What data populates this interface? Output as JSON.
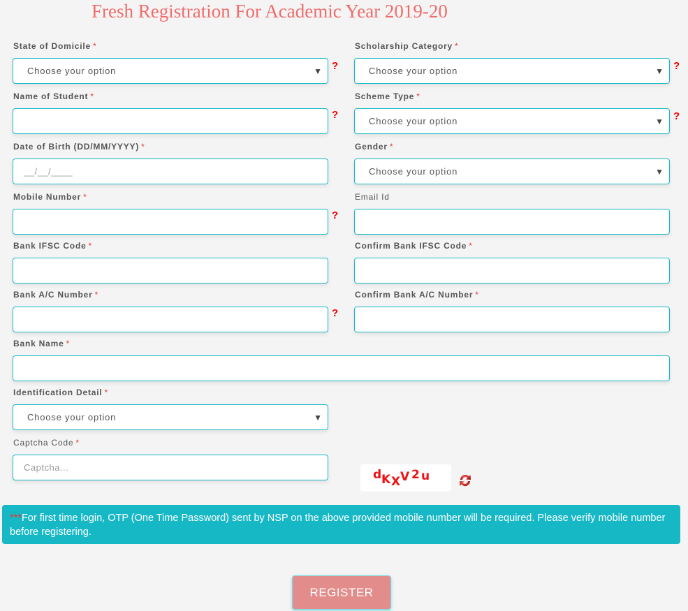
{
  "page": {
    "title": "Fresh Registration For Academic Year 2019-20"
  },
  "form": {
    "state_of_domicile": {
      "label": "State of Domicile",
      "required": "*",
      "value": "Choose your option",
      "help": "?"
    },
    "scholarship_category": {
      "label": "Scholarship Category",
      "required": "*",
      "value": "Choose your option",
      "help": "?"
    },
    "name_of_student": {
      "label": "Name of Student",
      "required": "*",
      "value": "",
      "help": "?"
    },
    "scheme_type": {
      "label": "Scheme Type",
      "required": "*",
      "value": "Choose your option",
      "help": "?"
    },
    "date_of_birth": {
      "label": "Date of Birth (DD/MM/YYYY)",
      "required": "*",
      "placeholder": "__/__/____"
    },
    "gender": {
      "label": "Gender",
      "required": "*",
      "value": "Choose your option"
    },
    "mobile_number": {
      "label": "Mobile Number",
      "required": "*",
      "value": "",
      "help": "?"
    },
    "email_id": {
      "label": "Email Id",
      "value": ""
    },
    "bank_ifsc": {
      "label": "Bank IFSC Code",
      "required": "*",
      "value": ""
    },
    "confirm_bank_ifsc": {
      "label": "Confirm Bank IFSC Code",
      "required": "*",
      "value": ""
    },
    "bank_ac_number": {
      "label": "Bank A/C Number",
      "required": "*",
      "value": "",
      "help": "?"
    },
    "confirm_bank_ac_number": {
      "label": "Confirm Bank A/C Number",
      "required": "*",
      "value": ""
    },
    "bank_name": {
      "label": "Bank Name",
      "required": "*",
      "value": ""
    },
    "identification_detail": {
      "label": "Identification Detail",
      "required": "*",
      "value": "Choose your option"
    },
    "captcha": {
      "label": "Captcha Code",
      "required": "*",
      "placeholder": "Captcha...",
      "image_text": [
        "d",
        "K",
        "X",
        "V",
        "2",
        "u"
      ]
    },
    "dropdown_arrow": "▼"
  },
  "notice": {
    "stars": "***",
    "text": "For first time login, OTP (One Time Password) sent by NSP on the above provided mobile number will be required. Please verify mobile number before registering."
  },
  "register_button": "REGISTER"
}
